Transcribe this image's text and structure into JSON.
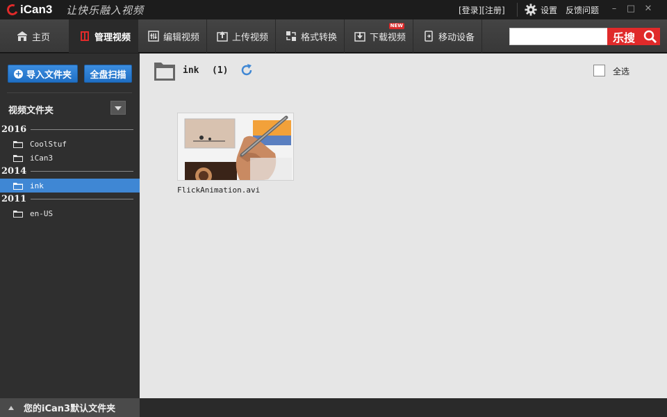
{
  "app": {
    "name": "iCan3",
    "slogan": "让快乐融入视频",
    "login": "[登录][注册]",
    "settings": "设置",
    "feedback": "反馈问题",
    "minimize": "–",
    "maximize": "□",
    "close": "✕"
  },
  "nav": {
    "items": [
      {
        "label": "主页",
        "icon": "home-icon"
      },
      {
        "label": "管理视频",
        "icon": "manage-video-icon"
      },
      {
        "label": "编辑视频",
        "icon": "edit-video-icon"
      },
      {
        "label": "上传视频",
        "icon": "upload-icon"
      },
      {
        "label": "格式转换",
        "icon": "convert-icon"
      },
      {
        "label": "下载视频",
        "icon": "download-icon",
        "badge": "NEW"
      },
      {
        "label": "移动设备",
        "icon": "mobile-device-icon"
      }
    ],
    "search_value": "",
    "search_button": "乐搜"
  },
  "sidebar": {
    "import_button": "导入文件夹",
    "scan_button": "全盘扫描",
    "section_title": "视频文件夹",
    "groups": [
      {
        "year": "2016",
        "folders": [
          "CoolStuf",
          "iCan3"
        ]
      },
      {
        "year": "2014",
        "folders": [
          "ink"
        ]
      },
      {
        "year": "2011",
        "folders": [
          "en-US"
        ]
      }
    ],
    "footer": "您的iCan3默认文件夹"
  },
  "main": {
    "folder_name": "ink",
    "count": "(1)",
    "select_all": "全选",
    "videos": [
      {
        "filename": "FlickAnimation.avi"
      }
    ]
  },
  "colors": {
    "accent_red": "#e02a2a",
    "accent_blue": "#3f87d4",
    "nav_bg": "#3e3e3e",
    "sidebar_bg": "#2f2f2f",
    "main_bg": "#e6e6e6"
  }
}
